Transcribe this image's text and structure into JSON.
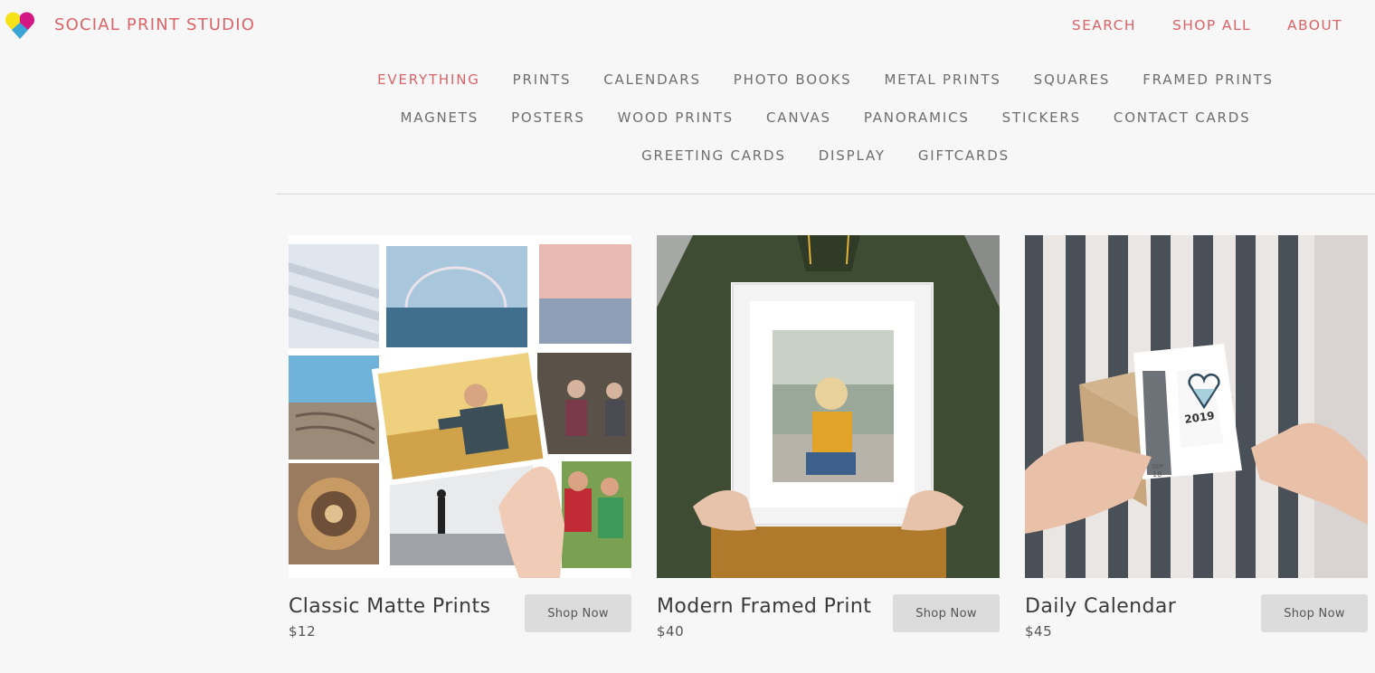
{
  "brand": {
    "name": "SOCIAL PRINT STUDIO",
    "logo_icon": "heart-logo-icon"
  },
  "topnav": [
    {
      "label": "SEARCH"
    },
    {
      "label": "SHOP ALL"
    },
    {
      "label": "ABOUT"
    }
  ],
  "categories": {
    "active": "EVERYTHING",
    "rows": [
      [
        "EVERYTHING",
        "PRINTS",
        "CALENDARS",
        "PHOTO BOOKS",
        "METAL PRINTS",
        "SQUARES",
        "FRAMED PRINTS"
      ],
      [
        "MAGNETS",
        "POSTERS",
        "WOOD PRINTS",
        "CANVAS",
        "PANORAMICS",
        "STICKERS",
        "CONTACT CARDS"
      ],
      [
        "GREETING CARDS",
        "DISPLAY",
        "GIFTCARDS"
      ]
    ]
  },
  "products": [
    {
      "name": "Classic Matte Prints",
      "price": "$12",
      "button": "Shop Now"
    },
    {
      "name": "Modern Framed Print",
      "price": "$40",
      "button": "Shop Now"
    },
    {
      "name": "Daily Calendar",
      "price": "$45",
      "button": "Shop Now"
    }
  ],
  "calendar_photo": {
    "year": "2019",
    "month": "SEP",
    "day": "18"
  },
  "colors": {
    "accent": "#d9646a",
    "nav_text": "#6e6e6e",
    "button_bg": "#dcdcdc",
    "background": "#f7f7f7"
  }
}
